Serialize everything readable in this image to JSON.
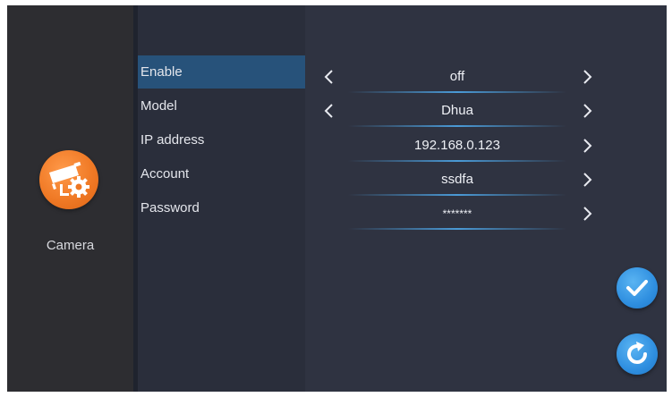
{
  "app": {
    "name": "Camera",
    "icon": "camera-settings-icon",
    "icon_color": "#f07a26"
  },
  "menu": {
    "items": [
      {
        "label": "Enable",
        "active": true
      },
      {
        "label": "Model",
        "active": false
      },
      {
        "label": "IP address",
        "active": false
      },
      {
        "label": "Account",
        "active": false
      },
      {
        "label": "Password",
        "active": false
      }
    ]
  },
  "settings": {
    "rows": [
      {
        "value": "off",
        "left_arrow": true,
        "right_arrow": true
      },
      {
        "value": "Dhua",
        "left_arrow": true,
        "right_arrow": true
      },
      {
        "value": "192.168.0.123",
        "left_arrow": false,
        "right_arrow": true
      },
      {
        "value": "ssdfa",
        "left_arrow": false,
        "right_arrow": true
      },
      {
        "value": "*******",
        "left_arrow": false,
        "right_arrow": true
      }
    ]
  },
  "actions": {
    "confirm_icon": "checkmark-icon",
    "reset_icon": "refresh-icon",
    "accent_color": "#2f8fe0"
  },
  "colors": {
    "active_menu": "#27527a",
    "background": "#2b2e3a"
  }
}
